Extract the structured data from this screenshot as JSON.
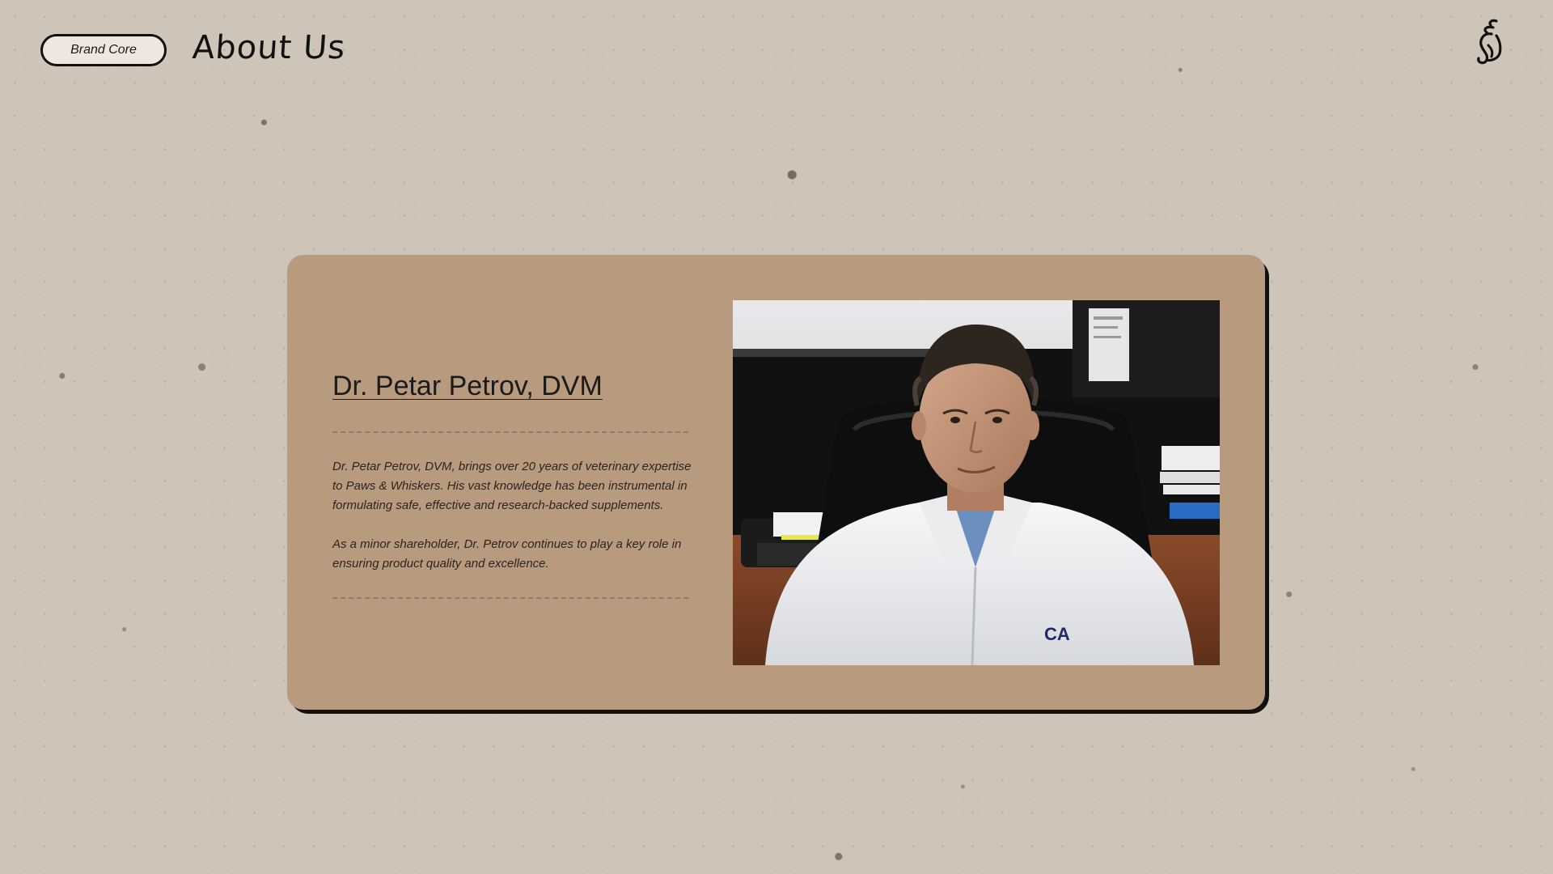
{
  "header": {
    "badge_label": "Brand Core",
    "title": "About Us",
    "logo_icon": "snail-swirl-logo"
  },
  "profile": {
    "name": "Dr. Petar Petrov, DVM",
    "bio_paragraphs": [
      "Dr. Petar Petrov, DVM, brings over 20 years of veterinary expertise to Paws & Whiskers. His vast knowledge has been instrumental in formulating safe, effective and research-backed supplements.",
      "As a minor shareholder, Dr. Petrov continues to play a key role in ensuring product quality and excellence."
    ],
    "photo_icon": "doctor-portrait-photo",
    "coat_logo_text": "CA"
  },
  "colors": {
    "background": "#cfc4b8",
    "card": "#b89a7f",
    "card_shadow": "#111111",
    "badge_fill": "#efe7df",
    "text": "#1b1b1b"
  }
}
